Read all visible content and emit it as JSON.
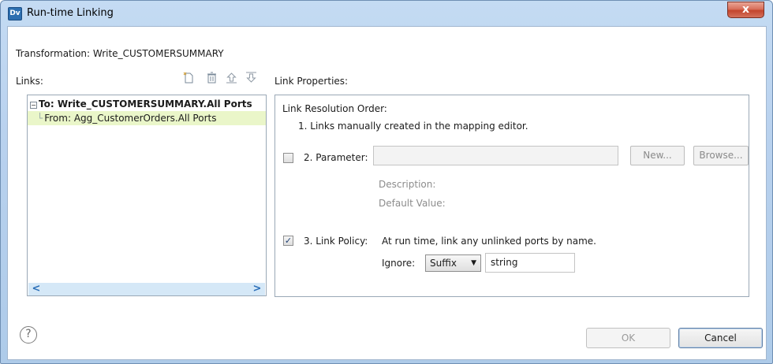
{
  "window": {
    "title": "Run-time Linking",
    "app_icon": "Dv",
    "close_symbol": "x"
  },
  "transformation_label": "Transformation: Write_CUSTOMERSUMMARY",
  "links": {
    "label": "Links:",
    "toolbar": [
      "new-link-icon",
      "delete-icon",
      "move-up-icon",
      "move-down-icon"
    ],
    "tree": {
      "root_toggle": "−",
      "root": "To: Write_CUSTOMERSUMMARY.All Ports",
      "child_guide": "└",
      "child": "From: Agg_CustomerOrders.All Ports"
    },
    "scroll_left": "<",
    "scroll_right": ">"
  },
  "link_properties": {
    "label": "Link Properties:",
    "resolution_order_label": "Link Resolution Order:",
    "item1": "1. Links manually created in the mapping editor.",
    "parameter": {
      "checked": false,
      "label": "2. Parameter:",
      "value": "",
      "new_button": "New...",
      "browse_button": "Browse...",
      "description_label": "Description:",
      "default_value_label": "Default Value:"
    },
    "link_policy": {
      "checked": true,
      "check_mark": "✓",
      "label": "3. Link Policy:",
      "text": "At run time, link any unlinked ports by name.",
      "ignore_label": "Ignore:",
      "ignore_select": "Suffix",
      "ignore_value": "string"
    }
  },
  "footer": {
    "help_symbol": "?",
    "ok_button": "OK",
    "cancel_button": "Cancel"
  },
  "colors": {
    "selection": "#eaf6c9",
    "titlebar": "#b8d1ee",
    "close": "#c3452d"
  }
}
